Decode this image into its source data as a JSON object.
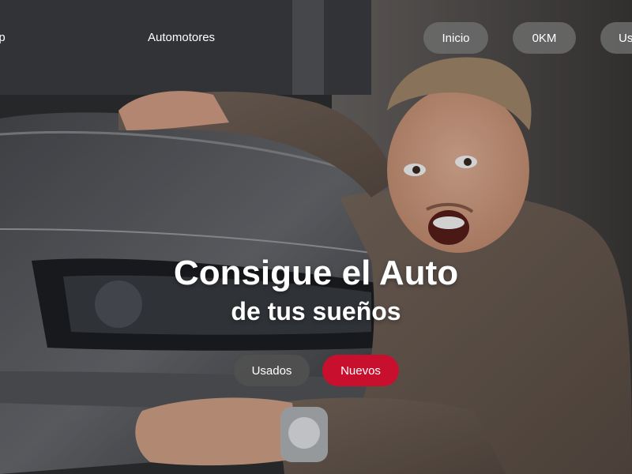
{
  "nav": {
    "brand": "pp",
    "link": "Automotores",
    "buttons": [
      {
        "label": "Inicio"
      },
      {
        "label": "0KM"
      },
      {
        "label": "Us"
      }
    ]
  },
  "hero": {
    "headline": "Consigue el Auto",
    "subheadline": "de tus sueños",
    "cta_secondary": "Usados",
    "cta_primary": "Nuevos"
  },
  "colors": {
    "accent": "#c8102e",
    "pill_bg": "#6e6e6e"
  }
}
